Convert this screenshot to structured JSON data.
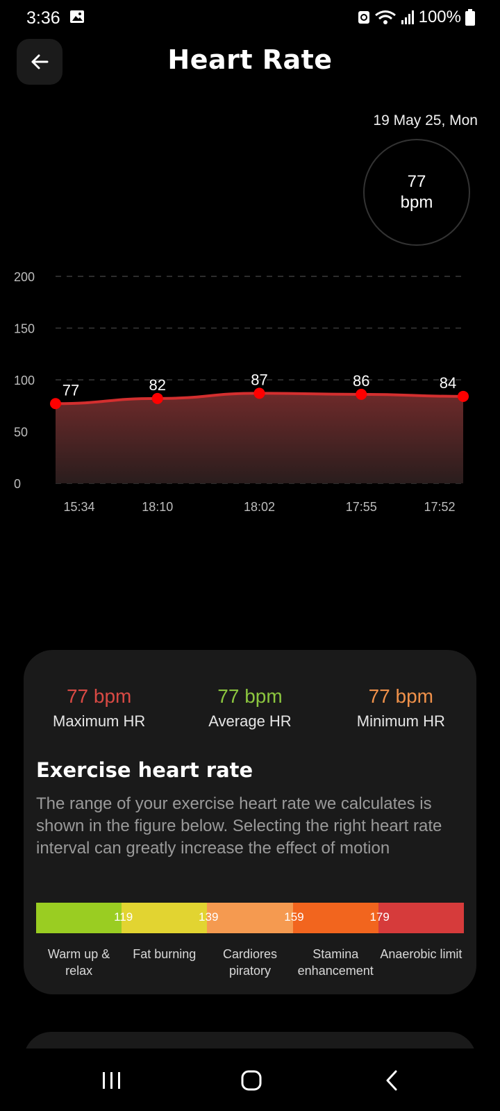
{
  "status_bar": {
    "time": "3:36",
    "battery": "100%",
    "icons": [
      "gallery-icon",
      "data-saver-icon",
      "wifi-icon",
      "signal-icon",
      "battery-icon"
    ]
  },
  "header": {
    "title": "Heart Rate",
    "back_icon": "arrow-left-icon"
  },
  "summary": {
    "date": "19 May 25, Mon",
    "value": "77",
    "unit": "bpm"
  },
  "chart_data": {
    "type": "area",
    "categories": [
      "15:34",
      "18:10",
      "18:02",
      "17:55",
      "17:52"
    ],
    "values": [
      77,
      82,
      87,
      86,
      84
    ],
    "y_ticks": [
      "200",
      "150",
      "100",
      "50",
      "0"
    ],
    "ylim": [
      0,
      200
    ],
    "grid": true,
    "colors": {
      "line": "#d32f2f",
      "point": "#ff0000",
      "fill_top": "#6e2a2a",
      "fill_bottom": "#2a1d1d"
    }
  },
  "stats": [
    {
      "value": "77 bpm",
      "label": "Maximum HR",
      "color": "#d94a44"
    },
    {
      "value": "77 bpm",
      "label": "Average HR",
      "color": "#8cc63f"
    },
    {
      "value": "77 bpm",
      "label": "Minimum HR",
      "color": "#f0914a"
    }
  ],
  "exercise": {
    "title": "Exercise heart rate",
    "description": "The range of your exercise heart rate we calculates is shown in the figure below. Selecting the right heart rate interval can greatly increase the effect of motion",
    "zones": [
      {
        "label": "Warm up & relax",
        "boundary": "119",
        "color": "#9acd22"
      },
      {
        "label": "Fat burning",
        "boundary": "139",
        "color": "#e2d431"
      },
      {
        "label": "Cardiores piratory",
        "boundary": "159",
        "color": "#f59a50"
      },
      {
        "label": "Stamina enhancement",
        "boundary": "179",
        "color": "#f2651e"
      },
      {
        "label": "Anaerobic limit",
        "boundary": "",
        "color": "#d63b3b"
      }
    ]
  },
  "nav": {
    "icons": [
      "recent-apps-icon",
      "home-icon",
      "back-nav-icon"
    ]
  }
}
